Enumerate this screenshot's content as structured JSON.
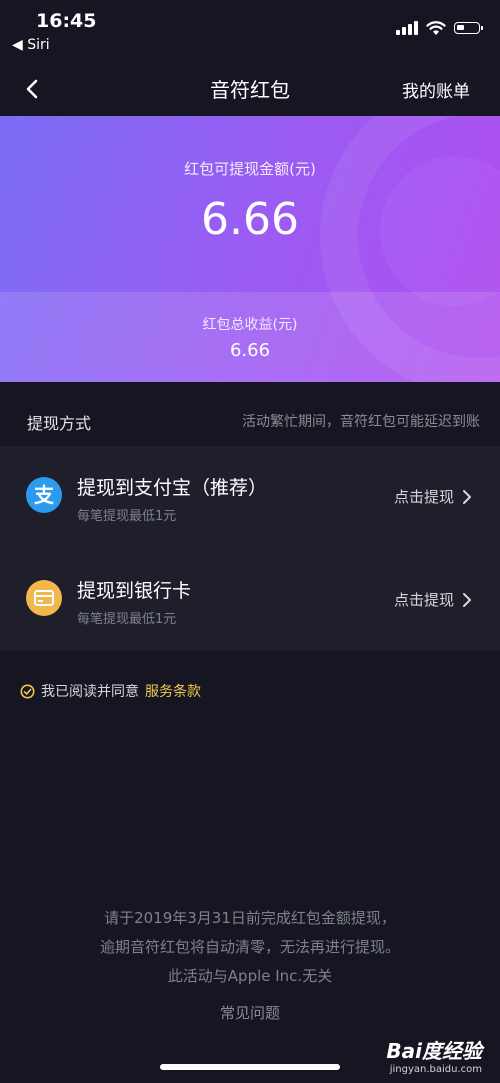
{
  "status_bar": {
    "time": "16:45",
    "back_app": "◀ Siri"
  },
  "nav": {
    "title": "音符红包",
    "right_label": "我的账单"
  },
  "hero": {
    "withdrawable_label": "红包可提现金额(元)",
    "withdrawable_amount": "6.66",
    "total_label": "红包总收益(元)",
    "total_amount": "6.66"
  },
  "section": {
    "title": "提现方式",
    "note": "活动繁忙期间，音符红包可能延迟到账"
  },
  "options": [
    {
      "title": "提现到支付宝（推荐）",
      "subtitle": "每笔提现最低1元",
      "action": "点击提现",
      "icon": "alipay-icon",
      "icon_color": "#2b9bf0",
      "icon_glyph": "支"
    },
    {
      "title": "提现到银行卡",
      "subtitle": "每笔提现最低1元",
      "action": "点击提现",
      "icon": "bank-card-icon",
      "icon_color": "#f2b84b"
    }
  ],
  "agreement": {
    "text": "我已阅读并同意",
    "link": "服务条款",
    "accent_color": "#f2c94c"
  },
  "footer": {
    "line1": "请于2019年3月31日前完成红包金额提现，",
    "line2": "逾期音符红包将自动清零，无法再进行提现。",
    "line3": "此活动与Apple Inc.无关",
    "faq": "常见问题"
  },
  "watermark": {
    "logo": "Bai度经验",
    "url": "jingyan.baidu.com"
  }
}
